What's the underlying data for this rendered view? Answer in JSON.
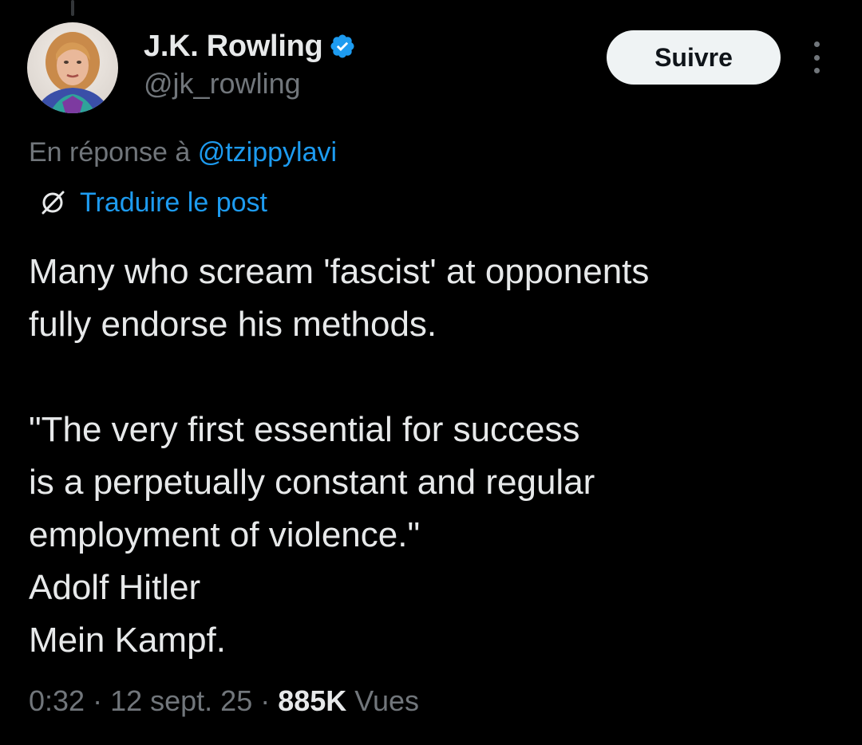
{
  "colors": {
    "background": "#000000",
    "text_primary": "#e7e9ea",
    "text_secondary": "#71767b",
    "accent": "#1d9bf0",
    "button_bg": "#eff3f4",
    "button_text": "#0f1419"
  },
  "author": {
    "display_name": "J.K. Rowling",
    "handle": "@jk_rowling",
    "verified_icon": "verified-badge-icon",
    "avatar_icon": "profile-photo"
  },
  "actions": {
    "follow_label": "Suivre",
    "more_icon": "more-options-icon"
  },
  "reply": {
    "prefix": "En réponse à",
    "mention": "@tzippylavi"
  },
  "translate": {
    "icon": "globe-slash-icon",
    "label": "Traduire le post"
  },
  "post": {
    "lines": [
      "Many who scream 'fascist' at opponents",
      "fully endorse his methods.",
      "",
      "\"The very first essential for success",
      "is a perpetually constant and regular",
      "employment of violence.\"",
      "Adolf Hitler",
      "Mein Kampf."
    ]
  },
  "meta": {
    "time": "0:32",
    "date": "12 sept. 25",
    "views_count": "885K",
    "views_label": "Vues",
    "separator": "·"
  }
}
